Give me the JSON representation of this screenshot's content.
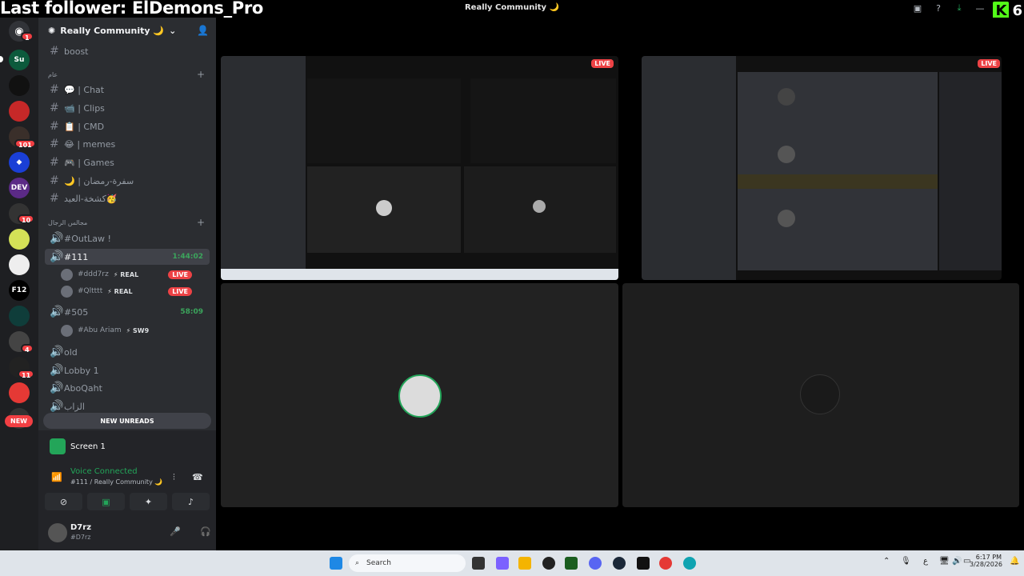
{
  "overlay": {
    "follower_text": "Last follower: ElDemons_Pro"
  },
  "window": {
    "title": "Really Community 🌙"
  },
  "kick": {
    "count": "6"
  },
  "server": {
    "name": "Really Community 🌙"
  },
  "rail_badges": {
    "b1": "1",
    "b101": "101",
    "b10": "10",
    "b4": "4",
    "b11": "11"
  },
  "channels": {
    "boost": "boost",
    "cat1": "عام",
    "chat": "💬 | Chat",
    "clips": "📹 | Clips",
    "cmd": "📋 | CMD",
    "memes": "😂 | memes",
    "games": "🎮 | Games",
    "ramadan": "🌙 | سفرة-رمضان",
    "eid": "كشخة-العيد🥳",
    "cat2": "مجالس الرجال",
    "outlaw": "#OutLaw !",
    "ch111": "#111",
    "ch111_dur": "1:44:02",
    "u1": "#ddd7rz",
    "u1_tag": "⚡ REAL",
    "u2": "#Qltttt",
    "u2_tag": "⚡ REAL",
    "live": "LIVE",
    "ch505": "#505",
    "ch505_dur": "58:09",
    "u3": "#Abu Ariam",
    "u3_tag": "⚡ SW9",
    "old": "old",
    "lobby": "Lobby 1",
    "aboqaht": "AboQaht",
    "last": "الزاب"
  },
  "unreads": {
    "label": "NEW UNREADS",
    "new": "NEW"
  },
  "voice": {
    "screen": "Screen 1",
    "status": "Voice Connected",
    "sub": "#111 / Really Community 🌙"
  },
  "user": {
    "name": "D7rz",
    "sub": "#D7rz"
  },
  "stage": {
    "live": "LIVE"
  },
  "taskbar": {
    "search": "Search",
    "time": "6:17 PM",
    "date": "3/28/2026"
  },
  "colors": {
    "accent_green": "#23a559",
    "live_red": "#ed4245",
    "kick_green": "#53fc18"
  }
}
